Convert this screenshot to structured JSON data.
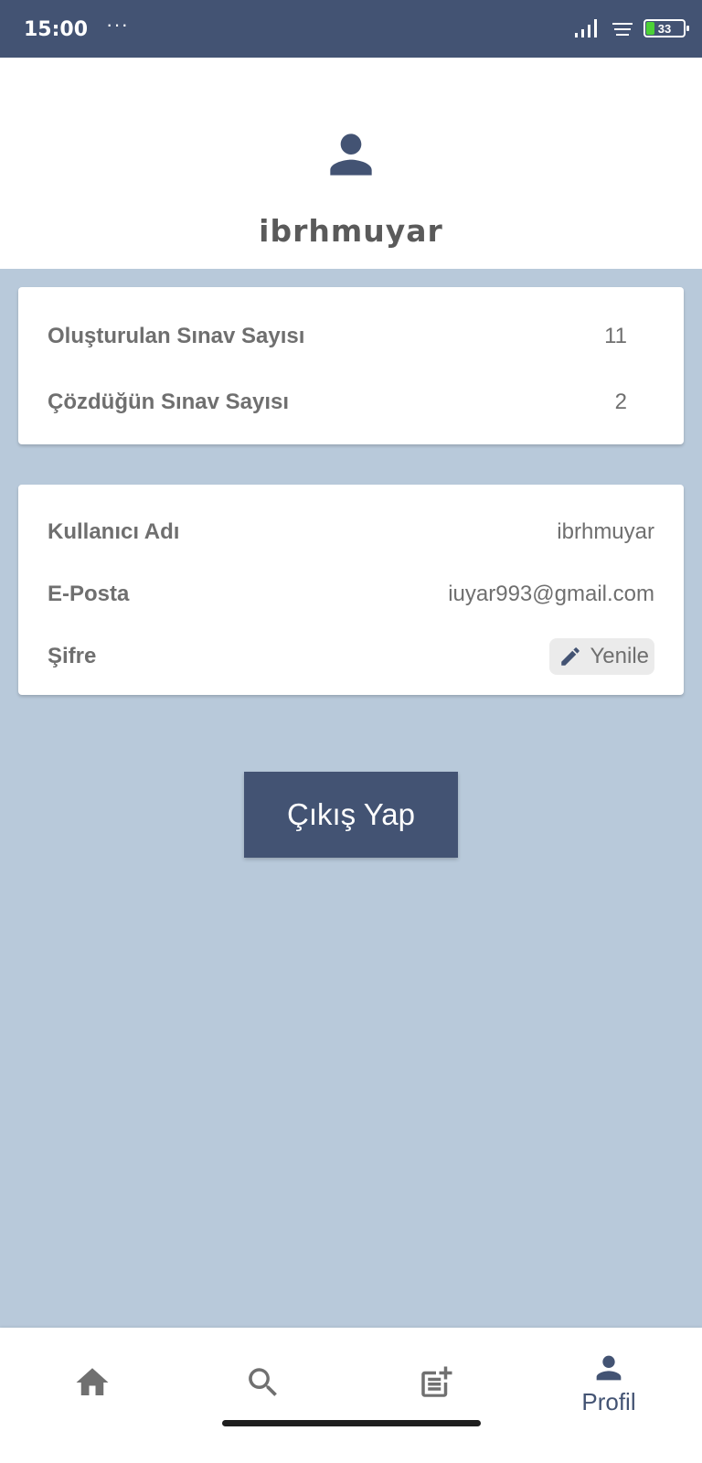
{
  "status_bar": {
    "time": "15:00",
    "dots": "···",
    "battery": "33"
  },
  "profile": {
    "username": "ibrhmuyar"
  },
  "stats": [
    {
      "label": "Oluşturulan Sınav Sayısı",
      "value": "11"
    },
    {
      "label": "Çözdüğün Sınav Sayısı",
      "value": "2"
    }
  ],
  "account": {
    "username_label": "Kullanıcı Adı",
    "username_value": "ibrhmuyar",
    "email_label": "E-Posta",
    "email_value": "iuyar993@gmail.com",
    "password_label": "Şifre",
    "renew_label": "Yenile"
  },
  "logout_label": "Çıkış Yap",
  "nav": {
    "home_icon": "home-icon",
    "search_icon": "search-icon",
    "create_icon": "post-add-icon",
    "profile_icon": "person-icon",
    "profile_label": "Profil",
    "active": "profile"
  },
  "colors": {
    "primary": "#435373",
    "background": "#b8c9da",
    "text": "#6f6f6f"
  }
}
